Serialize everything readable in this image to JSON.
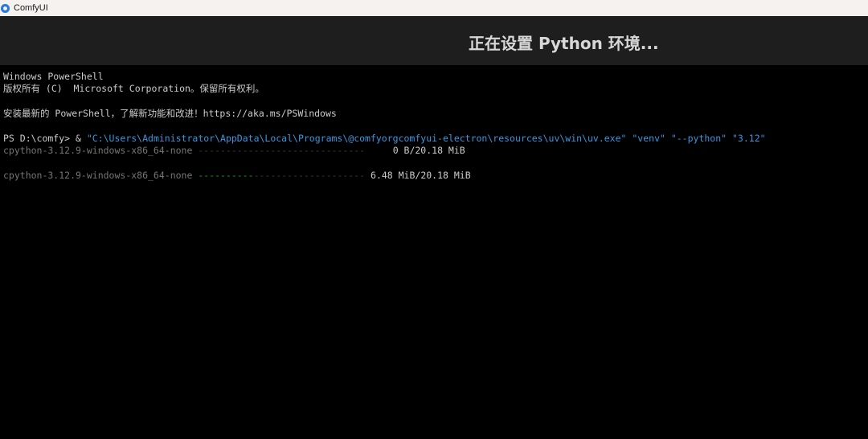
{
  "window": {
    "title": "ComfyUI",
    "icon": "comfyui-logo-icon"
  },
  "header": {
    "title": "正在设置 Python 环境..."
  },
  "terminal": {
    "lines": [
      {
        "text": "Windows PowerShell"
      },
      {
        "text": "版权所有 (C)  Microsoft Corporation。保留所有权利。"
      },
      {
        "text": "安装最新的 PowerShell，了解新功能和改进！https://aka.ms/PSWindows"
      },
      {
        "prompt": "PS D:\\comfy> & ",
        "command": "\"C:\\Users\\Administrator\\AppData\\Local\\Programs\\@comfyorgcomfyui-electron\\resources\\uv\\win\\uv.exe\" \"venv\" \"--python\" \"3.12\""
      }
    ],
    "downloads": [
      {
        "package": "cpython-3.12.9-windows-x86_64-none",
        "progress_fraction": 0.0,
        "size_text": "    0 B/20.18 MiB"
      },
      {
        "package": "cpython-3.12.9-windows-x86_64-none",
        "progress_fraction": 0.32,
        "size_text": "6.48 MiB/20.18 MiB"
      }
    ]
  },
  "colors": {
    "background": "#000000",
    "header_bg": "#1e1e1e",
    "command_string": "#3a96dd",
    "progress_fill": "#13a10e",
    "progress_empty": "#3a3a3a"
  }
}
